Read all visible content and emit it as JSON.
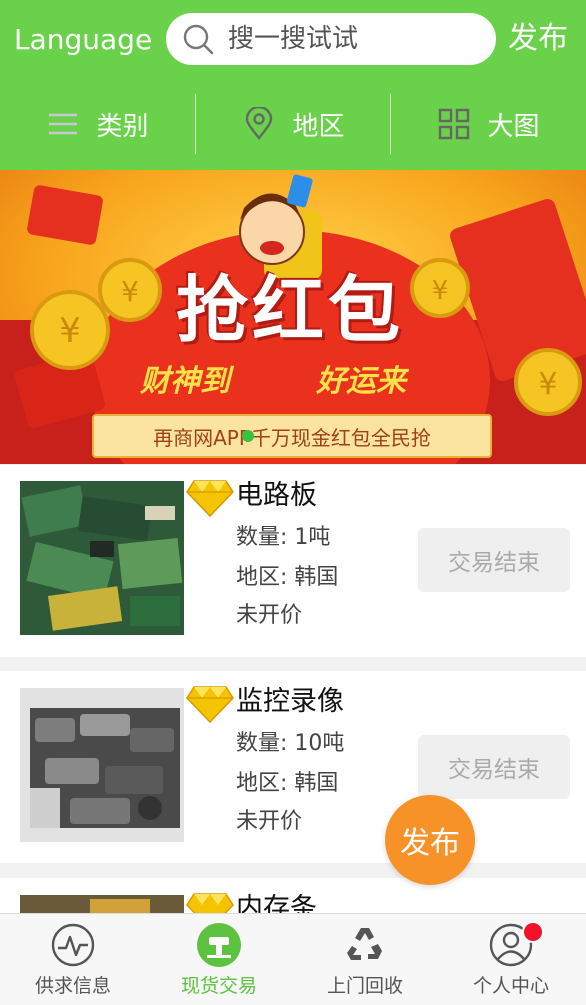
{
  "header": {
    "language_label": "Language",
    "search_placeholder": "搜一搜试试",
    "publish_label": "发布"
  },
  "filters": [
    {
      "label": "类别",
      "icon": "list-icon"
    },
    {
      "label": "地区",
      "icon": "location-pin-icon"
    },
    {
      "label": "大图",
      "icon": "grid-icon"
    }
  ],
  "banner": {
    "headline": "抢红包",
    "slogan_left": "财神到",
    "slogan_right": "好运来",
    "caption": "再商网APP千万现金红包全民抢"
  },
  "listings": [
    {
      "title": "电路板",
      "quantity": "数量: 1吨",
      "region": "地区: 韩国",
      "price": "未开价",
      "status": "交易结束",
      "icon": "diamond-icon"
    },
    {
      "title": "监控录像",
      "quantity": "数量: 10吨",
      "region": "地区: 韩国",
      "price": "未开价",
      "status": "交易结束",
      "icon": "diamond-icon"
    },
    {
      "title": "内存条",
      "icon": "diamond-icon"
    }
  ],
  "fab": {
    "label": "发布"
  },
  "tabs": [
    {
      "label": "供求信息",
      "icon": "pulse-icon",
      "active": false
    },
    {
      "label": "现货交易",
      "icon": "hammer-icon",
      "active": true
    },
    {
      "label": "上门回收",
      "icon": "recycle-icon",
      "active": false
    },
    {
      "label": "个人中心",
      "icon": "user-icon",
      "active": false
    }
  ],
  "colors": {
    "brand_green": "#6ad24a",
    "fab_orange": "#f79228",
    "badge_red": "#f2122a",
    "active_tab": "#5cc23f"
  }
}
